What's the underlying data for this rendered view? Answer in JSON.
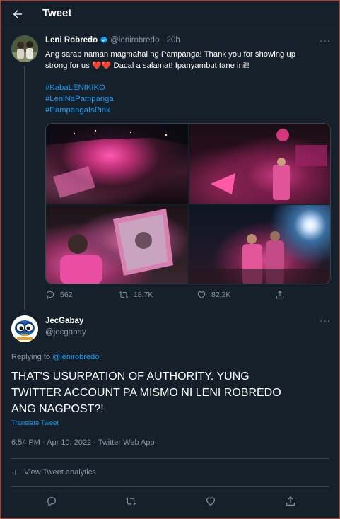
{
  "header": {
    "title": "Tweet",
    "back_icon": "arrow-left-icon"
  },
  "original_tweet": {
    "author_name": "Leni Robredo",
    "author_handle": "@lenirobredo",
    "separator": "·",
    "time": "20h",
    "text_line1": "Ang sarap naman magmahal ng Pampanga! Thank you for showing up",
    "text_line2_a": "strong for us ",
    "hearts": "❤️❤️",
    "text_line2_b": " Dacal a salamat! Ipanyambut tane ini!!",
    "hashtags": [
      "#KabaLENIKIKO",
      "#LeniNaPampanga",
      "#PampangaIsPink"
    ],
    "photos": [
      "crowd-aerial-photo",
      "stage-speaker-photo",
      "supporter-portrait-photo",
      "stage-night-photo"
    ],
    "replies": "562",
    "retweets": "18.7K",
    "likes": "82.2K"
  },
  "reply_tweet": {
    "author_name": "JecGabay",
    "author_handle": "@jecgabay",
    "replying_prefix": "Replying to ",
    "replying_to": "@lenirobredo",
    "text_line1": "THAT'S USURPATION OF AUTHORITY. YUNG",
    "text_line2": "TWITTER ACCOUNT PA MISMO NI LENI ROBREDO",
    "text_line3": "ANG NAGPOST?!",
    "translate_label": "Translate Tweet",
    "meta": "6:54 PM · Apr 10, 2022 · Twitter Web App",
    "analytics_label": "View Tweet analytics"
  },
  "colors": {
    "background": "#15202b",
    "accent": "#1d9bf0",
    "muted": "#8899a6",
    "border": "#38444d"
  }
}
